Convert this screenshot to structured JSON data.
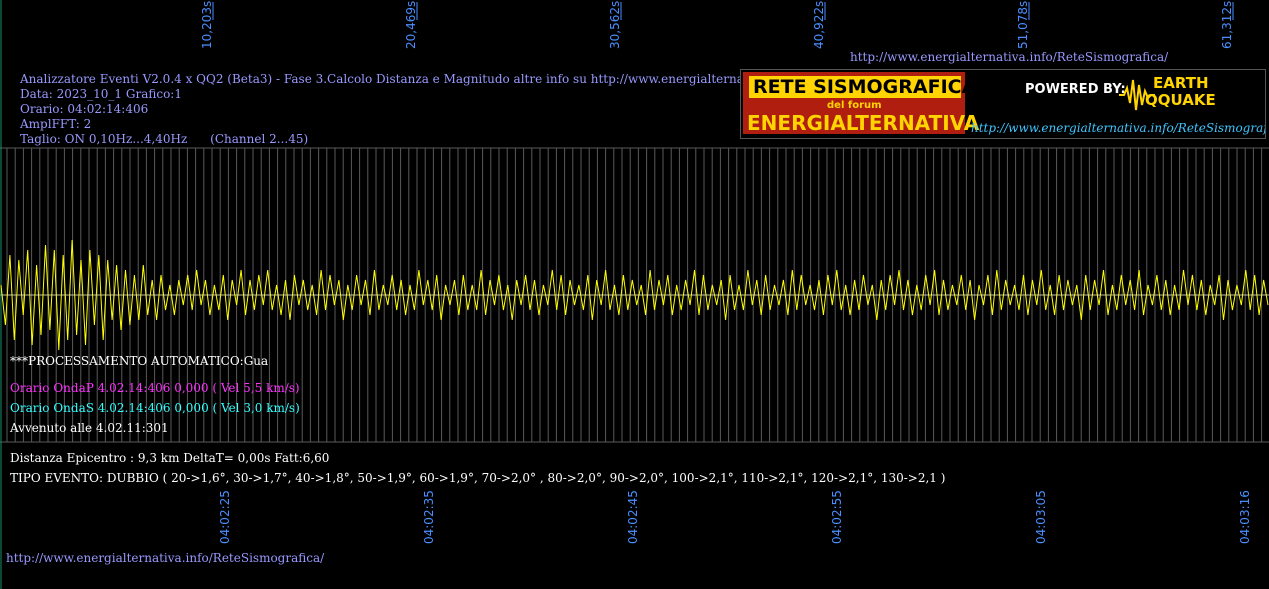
{
  "header": {
    "line1": "Analizzatore Eventi V2.0.4 x QQ2 (Beta3) - Fase 3.Calcolo Distanza e Magnitudo altre info su http://www.energialternativa.info/ReteSism",
    "line2": "Data: 2023_10_1 Grafico:1",
    "line3": "Orario: 04:02:14:406",
    "line4": "AmplFFT: 2",
    "line5": "Taglio: ON 0,10Hz...4,40Hz      (Channel 2...45)"
  },
  "top_url": "http://www.energialternativa.info/ReteSismografica/",
  "bottom_url": "http://www.energialternativa.info/ReteSismografica/",
  "banner": {
    "title1": "RETE SISMOGRAFICA",
    "title2": "del forum",
    "title3": "ENERGIALTERNATIVA",
    "powered": "POWERED BY:",
    "logo_top": "EARTH",
    "logo_bottom": "QQUAKE",
    "url": "http://www.energialternativa.info/ReteSismografica"
  },
  "processing": {
    "title": "***PROCESSAMENTO AUTOMATICO:Gua",
    "onda_p": "Orario OndaP 4.02.14:406  0,000 ( Vel 5,5 km/s)",
    "onda_s": "Orario OndaS 4.02.14:406  0,000 ( Vel 3,0 km/s)",
    "avvenuto": "Avvenuto alle 4.02.11:301",
    "distanza": "Distanza Epicentro : 9,3 km DeltaT= 0,00s  Fatt:6,60",
    "tipo_evento": "TIPO EVENTO: DUBBIO ( 20->1,6°, 30->1,7°, 40->1,8°, 50->1,9°, 60->1,9°, 70->2,0° , 80->2,0°, 90->2,0°, 100->2,1°, 110->2,1°, 120->2,1°, 130->2,1 )"
  },
  "colors": {
    "background": "#000000",
    "trace": "#ffff00",
    "grid": "#5a5a5a",
    "axis_text": "#4a8fff",
    "onda_p": "#ff33ff",
    "onda_s": "#33ffff",
    "header_text": "#9999ff"
  },
  "chart_data": {
    "type": "line",
    "series": [
      {
        "values": [
          0.2,
          -0.6,
          0.8,
          -0.9,
          0.7,
          -0.4,
          0.9,
          -1.0,
          0.6,
          -0.8,
          1.0,
          -0.7,
          0.9,
          -1.1,
          0.8,
          -0.9,
          1.1,
          -0.8,
          0.7,
          -1.0,
          0.9,
          -0.6,
          0.8,
          -0.9,
          0.7,
          -0.5,
          0.6,
          -0.7,
          0.5,
          -0.6,
          0.4,
          -0.5,
          0.6,
          -0.4,
          0.3,
          -0.5,
          0.4,
          -0.3,
          0.2,
          -0.4,
          0.3,
          -0.2,
          0.4,
          -0.3,
          0.5,
          -0.2,
          0.3,
          -0.4,
          0.2,
          -0.3,
          0.4,
          -0.5,
          0.3,
          -0.2,
          0.5,
          -0.4,
          0.3,
          -0.3,
          0.4,
          -0.2,
          0.5,
          -0.3,
          0.2,
          -0.4,
          0.3,
          -0.5,
          0.4,
          -0.2,
          0.3,
          -0.3,
          0.2,
          -0.4,
          0.5,
          -0.3,
          0.4,
          -0.2,
          0.3,
          -0.5,
          0.2,
          -0.3,
          0.4,
          -0.2,
          0.3,
          -0.4,
          0.5,
          -0.3,
          0.2,
          -0.2,
          0.4,
          -0.3,
          0.3,
          -0.4,
          0.2,
          -0.3,
          0.5,
          -0.2,
          0.3,
          -0.3,
          0.4,
          -0.5,
          0.2,
          -0.2,
          0.3,
          -0.4,
          0.4,
          -0.3,
          0.2,
          -0.3,
          0.5,
          -0.4,
          0.3,
          -0.2,
          0.4,
          -0.3,
          0.2,
          -0.5,
          0.3,
          -0.2,
          0.4,
          -0.3,
          0.3,
          -0.4,
          0.2,
          -0.2,
          0.5,
          -0.3,
          0.4,
          -0.4,
          0.3,
          -0.2,
          0.2,
          -0.3,
          0.4,
          -0.5,
          0.3,
          -0.2,
          0.5,
          -0.3,
          0.2,
          -0.4,
          0.4,
          -0.3,
          0.3,
          -0.2,
          0.2,
          -0.4,
          0.5,
          -0.3,
          0.3,
          -0.2,
          0.4,
          -0.4,
          0.2,
          -0.3,
          0.3,
          -0.2,
          0.5,
          -0.4,
          0.4,
          -0.3,
          0.2,
          -0.2,
          0.3,
          -0.5,
          0.4,
          -0.3,
          0.2,
          -0.3,
          0.5,
          -0.2,
          0.3,
          -0.4,
          0.4,
          -0.3,
          0.2,
          -0.2,
          0.3,
          -0.4,
          0.5,
          -0.3,
          0.4,
          -0.2,
          0.2,
          -0.3,
          0.3,
          -0.4,
          0.4,
          -0.2,
          0.5,
          -0.3,
          0.2,
          -0.4,
          0.3,
          -0.3,
          0.4,
          -0.2,
          0.2,
          -0.5,
          0.3,
          -0.3,
          0.4,
          -0.2,
          0.5,
          -0.3,
          0.3,
          -0.4,
          0.2,
          -0.3,
          0.4,
          -0.2,
          0.5,
          -0.4,
          0.3,
          -0.3,
          0.2,
          -0.2,
          0.4,
          -0.3,
          0.3,
          -0.5,
          0.2,
          -0.2,
          0.4,
          -0.4,
          0.5,
          -0.3,
          0.3,
          -0.2,
          0.2,
          -0.3,
          0.4,
          -0.4,
          0.3,
          -0.2,
          0.5,
          -0.3,
          0.2,
          -0.4,
          0.4,
          -0.3,
          0.3,
          -0.2,
          0.2,
          -0.5,
          0.4,
          -0.3,
          0.3,
          -0.2,
          0.5,
          -0.4,
          0.2,
          -0.3,
          0.4,
          -0.2,
          0.3,
          -0.3,
          0.5,
          -0.4,
          0.2,
          -0.2,
          0.4,
          -0.3,
          0.3,
          -0.4,
          0.2,
          -0.3,
          0.5,
          -0.2,
          0.4,
          -0.3,
          0.3,
          -0.4,
          0.2,
          -0.2,
          0.4,
          -0.5,
          0.3,
          -0.3,
          0.2,
          -0.2,
          0.5,
          -0.3,
          0.4,
          -0.4,
          0.3,
          -0.2
        ]
      }
    ],
    "top_ticks": [
      "10,203s",
      "20,469s",
      "30,562s",
      "40,922s",
      "51,078s",
      "61,312s"
    ],
    "bottom_ticks": [
      "04:02:25",
      "04:02:35",
      "04:02:45",
      "04:02:55",
      "04:03:05",
      "04:03:16"
    ],
    "ylim": [
      -1.2,
      1.2
    ],
    "grid": true
  }
}
